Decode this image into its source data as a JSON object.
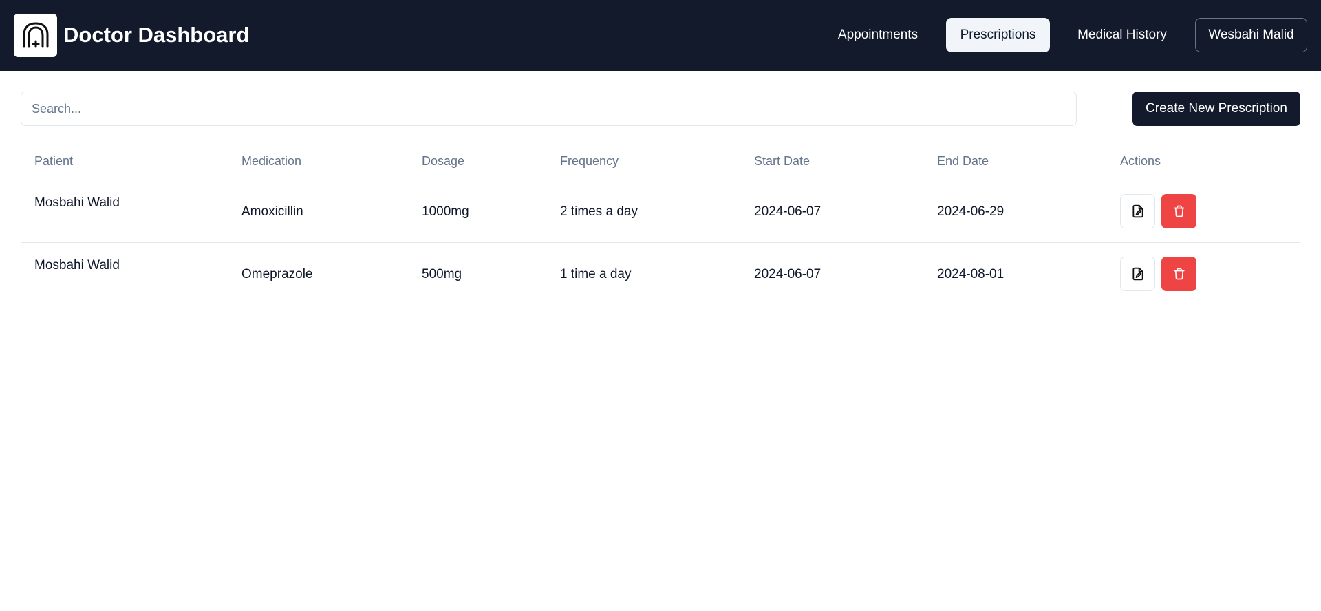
{
  "app": {
    "title": "Doctor Dashboard",
    "logo_icon": "medical-arch-icon"
  },
  "nav": {
    "appointments": "Appointments",
    "prescriptions": "Prescriptions",
    "medical_history": "Medical History",
    "user": "Wesbahi Malid",
    "active": "Prescriptions"
  },
  "toolbar": {
    "search_placeholder": "Search...",
    "search_value": "",
    "create_label": "Create New Prescription"
  },
  "table": {
    "headers": {
      "patient": "Patient",
      "medication": "Medication",
      "dosage": "Dosage",
      "frequency": "Frequency",
      "start_date": "Start Date",
      "end_date": "End Date",
      "actions": "Actions"
    },
    "rows": [
      {
        "patient": "Mosbahi Walid",
        "medication": "Amoxicillin",
        "dosage": "1000mg",
        "frequency": "2 times a day",
        "start_date": "2024-06-07",
        "end_date": "2024-06-29"
      },
      {
        "patient": "Mosbahi Walid",
        "medication": "Omeprazole",
        "dosage": "500mg",
        "frequency": "1 time a day",
        "start_date": "2024-06-07",
        "end_date": "2024-08-01"
      }
    ],
    "action_icons": {
      "edit": "file-edit-icon",
      "delete": "trash-icon"
    }
  },
  "colors": {
    "topbar": "#121a2c",
    "accent_dark": "#121a2c",
    "danger": "#ef4444",
    "muted_text": "#64748b",
    "border": "#e2e8f0"
  }
}
